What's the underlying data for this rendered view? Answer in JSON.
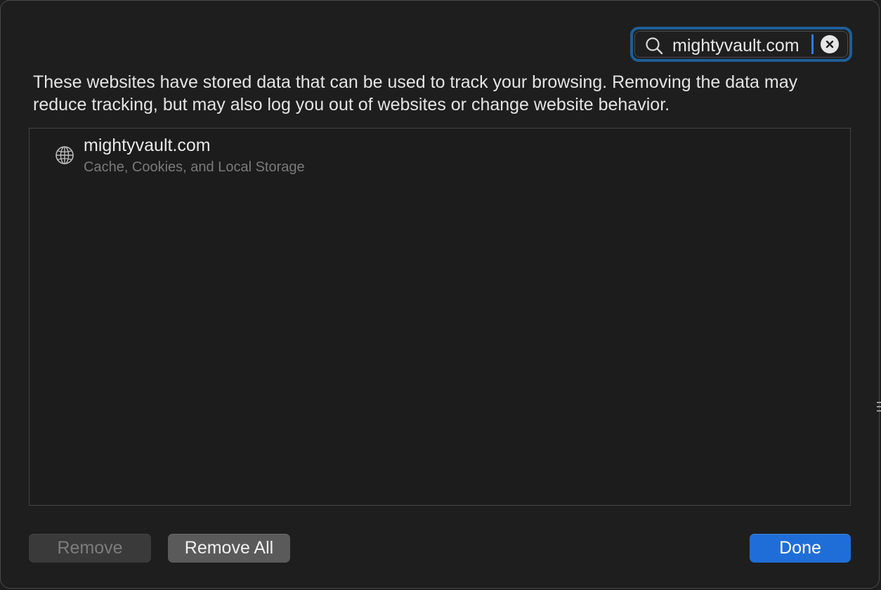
{
  "search": {
    "value": "mightyvault.com",
    "icon": "search-icon",
    "clear_icon": "clear-icon"
  },
  "description": "These websites have stored data that can be used to track your browsing. Removing the data may reduce tracking, but may also log you out of websites or change website behavior.",
  "websites": [
    {
      "name": "mightyvault.com",
      "detail": "Cache, Cookies, and Local Storage",
      "icon": "globe-icon"
    }
  ],
  "buttons": {
    "remove": "Remove",
    "remove_all": "Remove All",
    "done": "Done"
  },
  "colors": {
    "accent": "#1f6ed8",
    "focus_ring": "#1d5e96",
    "background": "#1e1e1e"
  }
}
